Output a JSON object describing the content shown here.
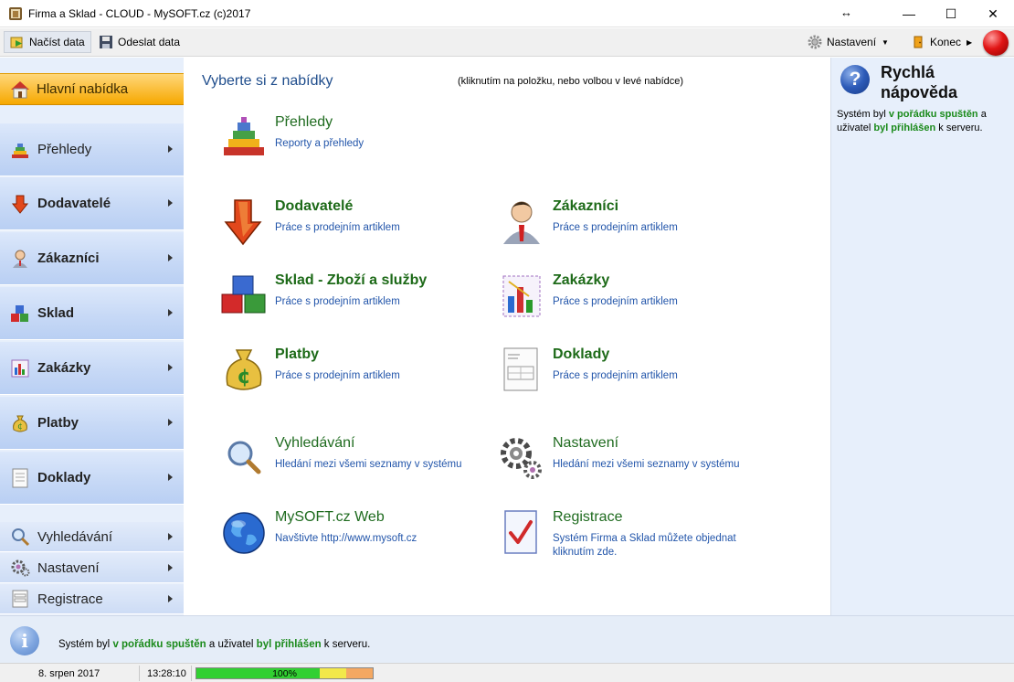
{
  "window": {
    "title": "Firma a Sklad - CLOUD - MySOFT.cz (c)2017",
    "resize_glyph": "↔",
    "minimize_glyph": "—",
    "maximize_glyph": "☐",
    "close_glyph": "✕"
  },
  "toolbar": {
    "load_label": "Načíst data",
    "save_label": "Odeslat data",
    "settings_label": "Nastavení",
    "exit_label": "Konec"
  },
  "sidebar": {
    "main_label": "Hlavní nabídka",
    "items": [
      {
        "label": "Přehledy",
        "icon": "pyramid-icon"
      },
      {
        "label": "Dodavatelé",
        "icon": "arrow-down-icon"
      },
      {
        "label": "Zákazníci",
        "icon": "person-icon"
      },
      {
        "label": "Sklad",
        "icon": "cubes-icon"
      },
      {
        "label": "Zakázky",
        "icon": "chart-icon"
      },
      {
        "label": "Platby",
        "icon": "money-bag-icon"
      },
      {
        "label": "Doklady",
        "icon": "document-icon"
      }
    ],
    "small_items": [
      {
        "label": "Vyhledávání",
        "icon": "search-icon"
      },
      {
        "label": "Nastavení",
        "icon": "gears-icon"
      },
      {
        "label": "Registrace",
        "icon": "form-icon"
      }
    ]
  },
  "main": {
    "title": "Vyberte si z nabídky",
    "hint": "(kliknutím na položku, nebo volbou v levé nabídce)",
    "tiles": {
      "prehledy": {
        "title": "Přehledy",
        "desc": "Reporty a přehledy"
      },
      "dodavatele": {
        "title": "Dodavatelé",
        "desc": "Práce s prodejním artiklem"
      },
      "zakaznici": {
        "title": "Zákazníci",
        "desc": "Práce s prodejním artiklem"
      },
      "sklad": {
        "title": "Sklad - Zboží a služby",
        "desc": "Práce s prodejním artiklem"
      },
      "zakazky": {
        "title": "Zakázky",
        "desc": "Práce s prodejním artiklem"
      },
      "platby": {
        "title": "Platby",
        "desc": "Práce s prodejním artiklem"
      },
      "doklady": {
        "title": "Doklady",
        "desc": "Práce s prodejním artiklem"
      },
      "vyhledavani": {
        "title": "Vyhledávání",
        "desc": "Hledání mezi všemi seznamy v systému"
      },
      "nastaveni": {
        "title": "Nastavení",
        "desc": "Hledání mezi všemi seznamy v systému"
      },
      "web": {
        "title": "MySOFT.cz Web",
        "desc": "Navštivte http://www.mysoft.cz"
      },
      "registrace": {
        "title": "Registrace",
        "desc": "Systém Firma a Sklad můžete objednat kliknutím zde."
      }
    }
  },
  "help": {
    "icon_glyph": "?",
    "title": "Rychlá nápověda",
    "text_1": "Systém byl ",
    "text_2": "v pořádku spuštěn",
    "text_3": " a uživatel ",
    "text_4": "byl přihlášen",
    "text_5": " k serveru."
  },
  "info": {
    "icon_glyph": "i",
    "text_1": "Systém byl ",
    "text_2": "v pořádku spuštěn",
    "text_3": " a uživatel ",
    "text_4": "byl přihlášen",
    "text_5": " k serveru."
  },
  "status": {
    "date": "8. srpen 2017",
    "time": "13:28:10",
    "progress_label": "100%",
    "progress_value": 1.0
  },
  "colors": {
    "accent_orange": "#f6a800",
    "title_blue": "#1f4d8c",
    "tile_green": "#1d6a18",
    "link_blue": "#2255aa",
    "status_green": "#1a8a1a"
  }
}
